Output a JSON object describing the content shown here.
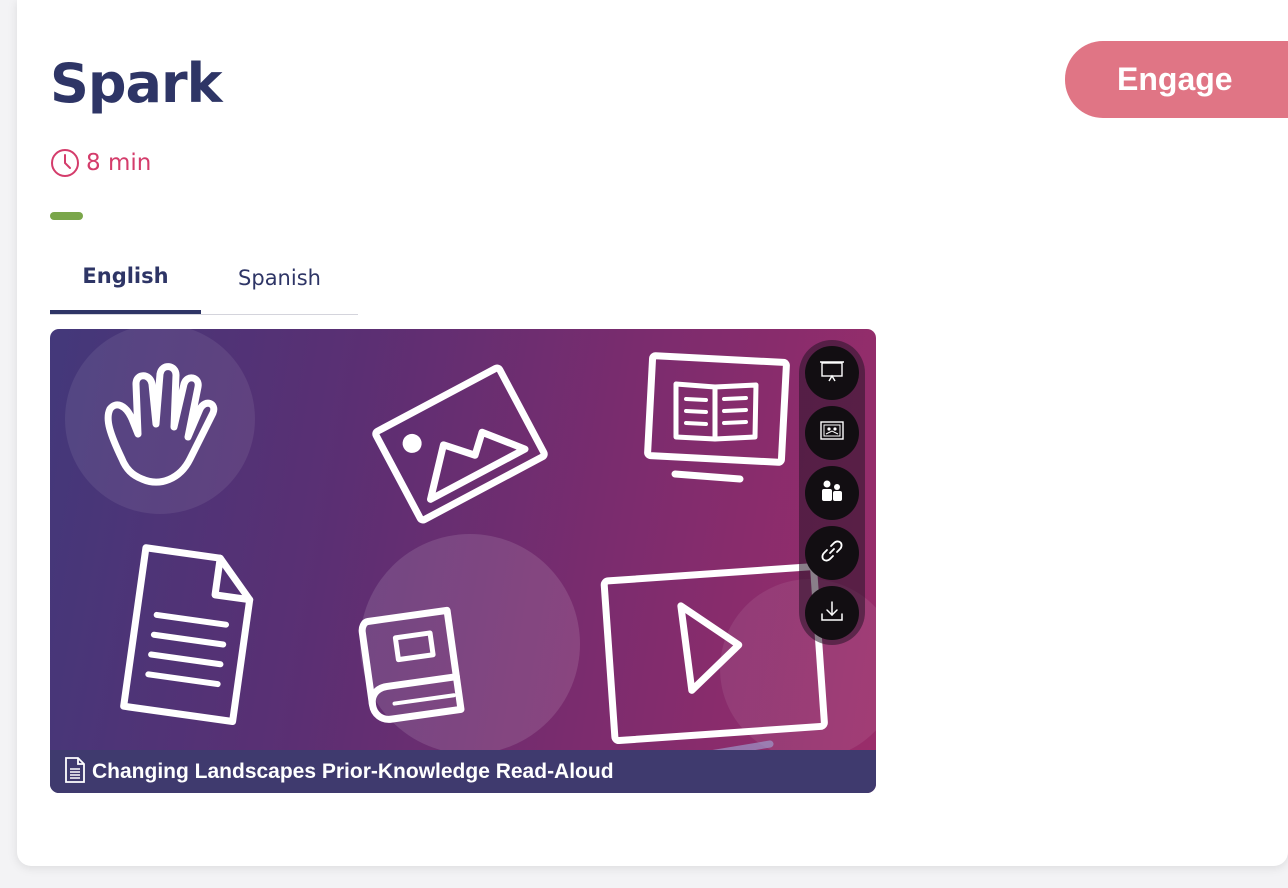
{
  "header": {
    "title": "Spark",
    "duration": "8 min",
    "engage_label": "Engage"
  },
  "tabs": [
    {
      "label": "English",
      "active": true
    },
    {
      "label": "Spanish",
      "active": false
    }
  ],
  "media": {
    "caption": "Changing Landscapes Prior-Knowledge Read-Aloud",
    "caption_icon": "document-icon",
    "actions": [
      {
        "name": "present-icon"
      },
      {
        "name": "classroom-screen-icon"
      },
      {
        "name": "assign-students-icon"
      },
      {
        "name": "link-icon"
      },
      {
        "name": "download-icon"
      }
    ]
  },
  "colors": {
    "title": "#2e3566",
    "duration": "#d43c6b",
    "engage": "#e07585",
    "progress": "#7aa64a"
  }
}
